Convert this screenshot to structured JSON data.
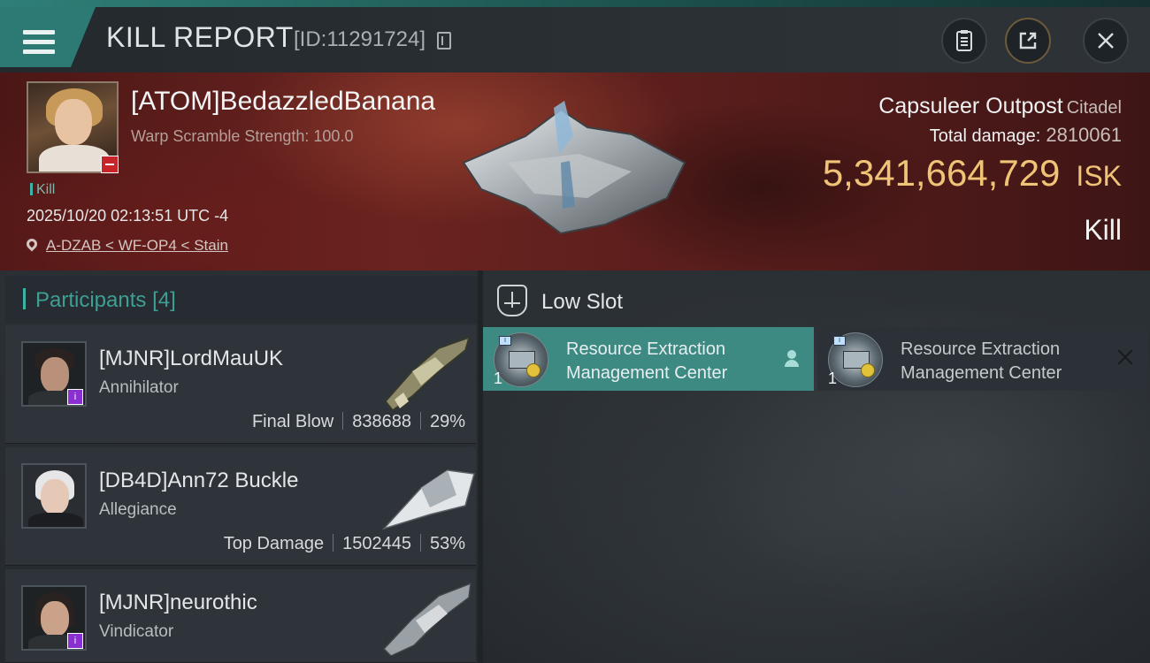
{
  "header": {
    "title": "KILL REPORT",
    "report_id": "[ID:11291724]",
    "menu_icon": "hamburger-icon",
    "buttons": {
      "clipboard_icon": "clipboard-icon",
      "share_icon": "share-icon",
      "close_icon": "close-icon"
    }
  },
  "victim": {
    "name": "[ATOM]BedazzledBanana",
    "subtitle": "Warp Scramble Strength: 100.0",
    "kill_tag": "Kill",
    "timestamp": "2025/10/20 02:13:51 UTC -4",
    "location": "A-DZAB < WF-OP4 < Stain",
    "ship_name": "Capsuleer Outpost",
    "ship_class": "Citadel",
    "total_damage_label": "Total damage:",
    "total_damage": "2810061",
    "isk_value": "5,341,664,729",
    "isk_unit": "ISK",
    "report_type": "Kill"
  },
  "participants": {
    "title": "Participants",
    "count": "[4]",
    "items": [
      {
        "name": "[MJNR]LordMauUK",
        "ship": "Annihilator",
        "role": "Final Blow",
        "damage": "838688",
        "percent": "29%",
        "badge": "i"
      },
      {
        "name": "[DB4D]Ann72 Buckle",
        "ship": "Allegiance",
        "role": "Top Damage",
        "damage": "1502445",
        "percent": "53%",
        "badge": ""
      },
      {
        "name": "[MJNR]neurothic",
        "ship": "Vindicator",
        "role": "",
        "damage": "",
        "percent": "",
        "badge": "i"
      }
    ]
  },
  "slots": {
    "title": "Low Slot",
    "modules": [
      {
        "name_line1": "Resource Extraction",
        "name_line2": "Management Center",
        "quantity": "1",
        "tag": "I"
      },
      {
        "name_line1": "Resource Extraction",
        "name_line2": "Management Center",
        "quantity": "1",
        "tag": "I"
      }
    ]
  },
  "colors": {
    "accent": "#3d8a82",
    "isk_gold": "#f0c476",
    "hero_red": "#6a2420",
    "badge_purple": "#8a2fd1",
    "minus_red": "#c8252b"
  }
}
